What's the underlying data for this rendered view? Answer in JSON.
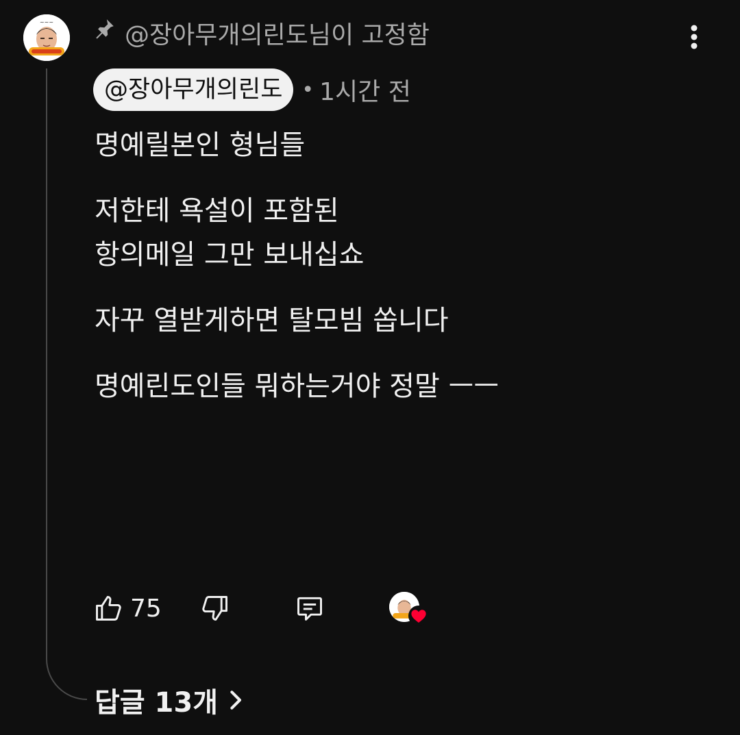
{
  "comment": {
    "pinned_label": "@장아무개의린도님이 고정함",
    "author": "@장아무개의린도",
    "separator": "•",
    "time": "1시간 전",
    "body_lines": [
      "명예릴본인 형님들",
      "",
      "저한테 욕설이 포함된",
      "항의메일 그만 보내십쇼",
      "",
      "자꾸 열받게하면 탈모빔 쏩니다",
      "",
      "명예린도인들 뭐하는거야 정말 ㅡㅡ"
    ]
  },
  "actions": {
    "like_count": "75"
  },
  "replies": {
    "label": "답글 13개"
  },
  "icons": {
    "pin": "pin-icon",
    "more": "more-vertical-icon",
    "like": "thumbs-up-icon",
    "dislike": "thumbs-down-icon",
    "reply": "comment-icon",
    "heart": "heart-icon",
    "chevron": "chevron-right-icon"
  },
  "colors": {
    "background": "#0f0f0f",
    "text_primary": "#f1f1f1",
    "text_secondary": "#aaaaaa",
    "author_chip_bg": "#f1f1f1",
    "heart": "#ff0033",
    "thread_line": "#4a4a4a"
  }
}
